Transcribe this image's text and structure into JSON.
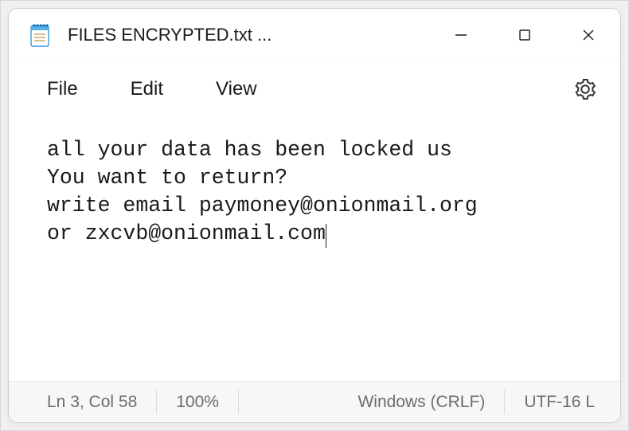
{
  "titlebar": {
    "title": "FILES ENCRYPTED.txt ..."
  },
  "menubar": {
    "file": "File",
    "edit": "Edit",
    "view": "View"
  },
  "content": {
    "line1": "all your data has been locked us",
    "line2": "You want to return?",
    "line3": "write email paymoney@onionmail.org",
    "line4": "or zxcvb@onionmail.com"
  },
  "statusbar": {
    "position": "Ln 3, Col 58",
    "zoom": "100%",
    "lineending": "Windows (CRLF)",
    "encoding": "UTF-16 L"
  }
}
